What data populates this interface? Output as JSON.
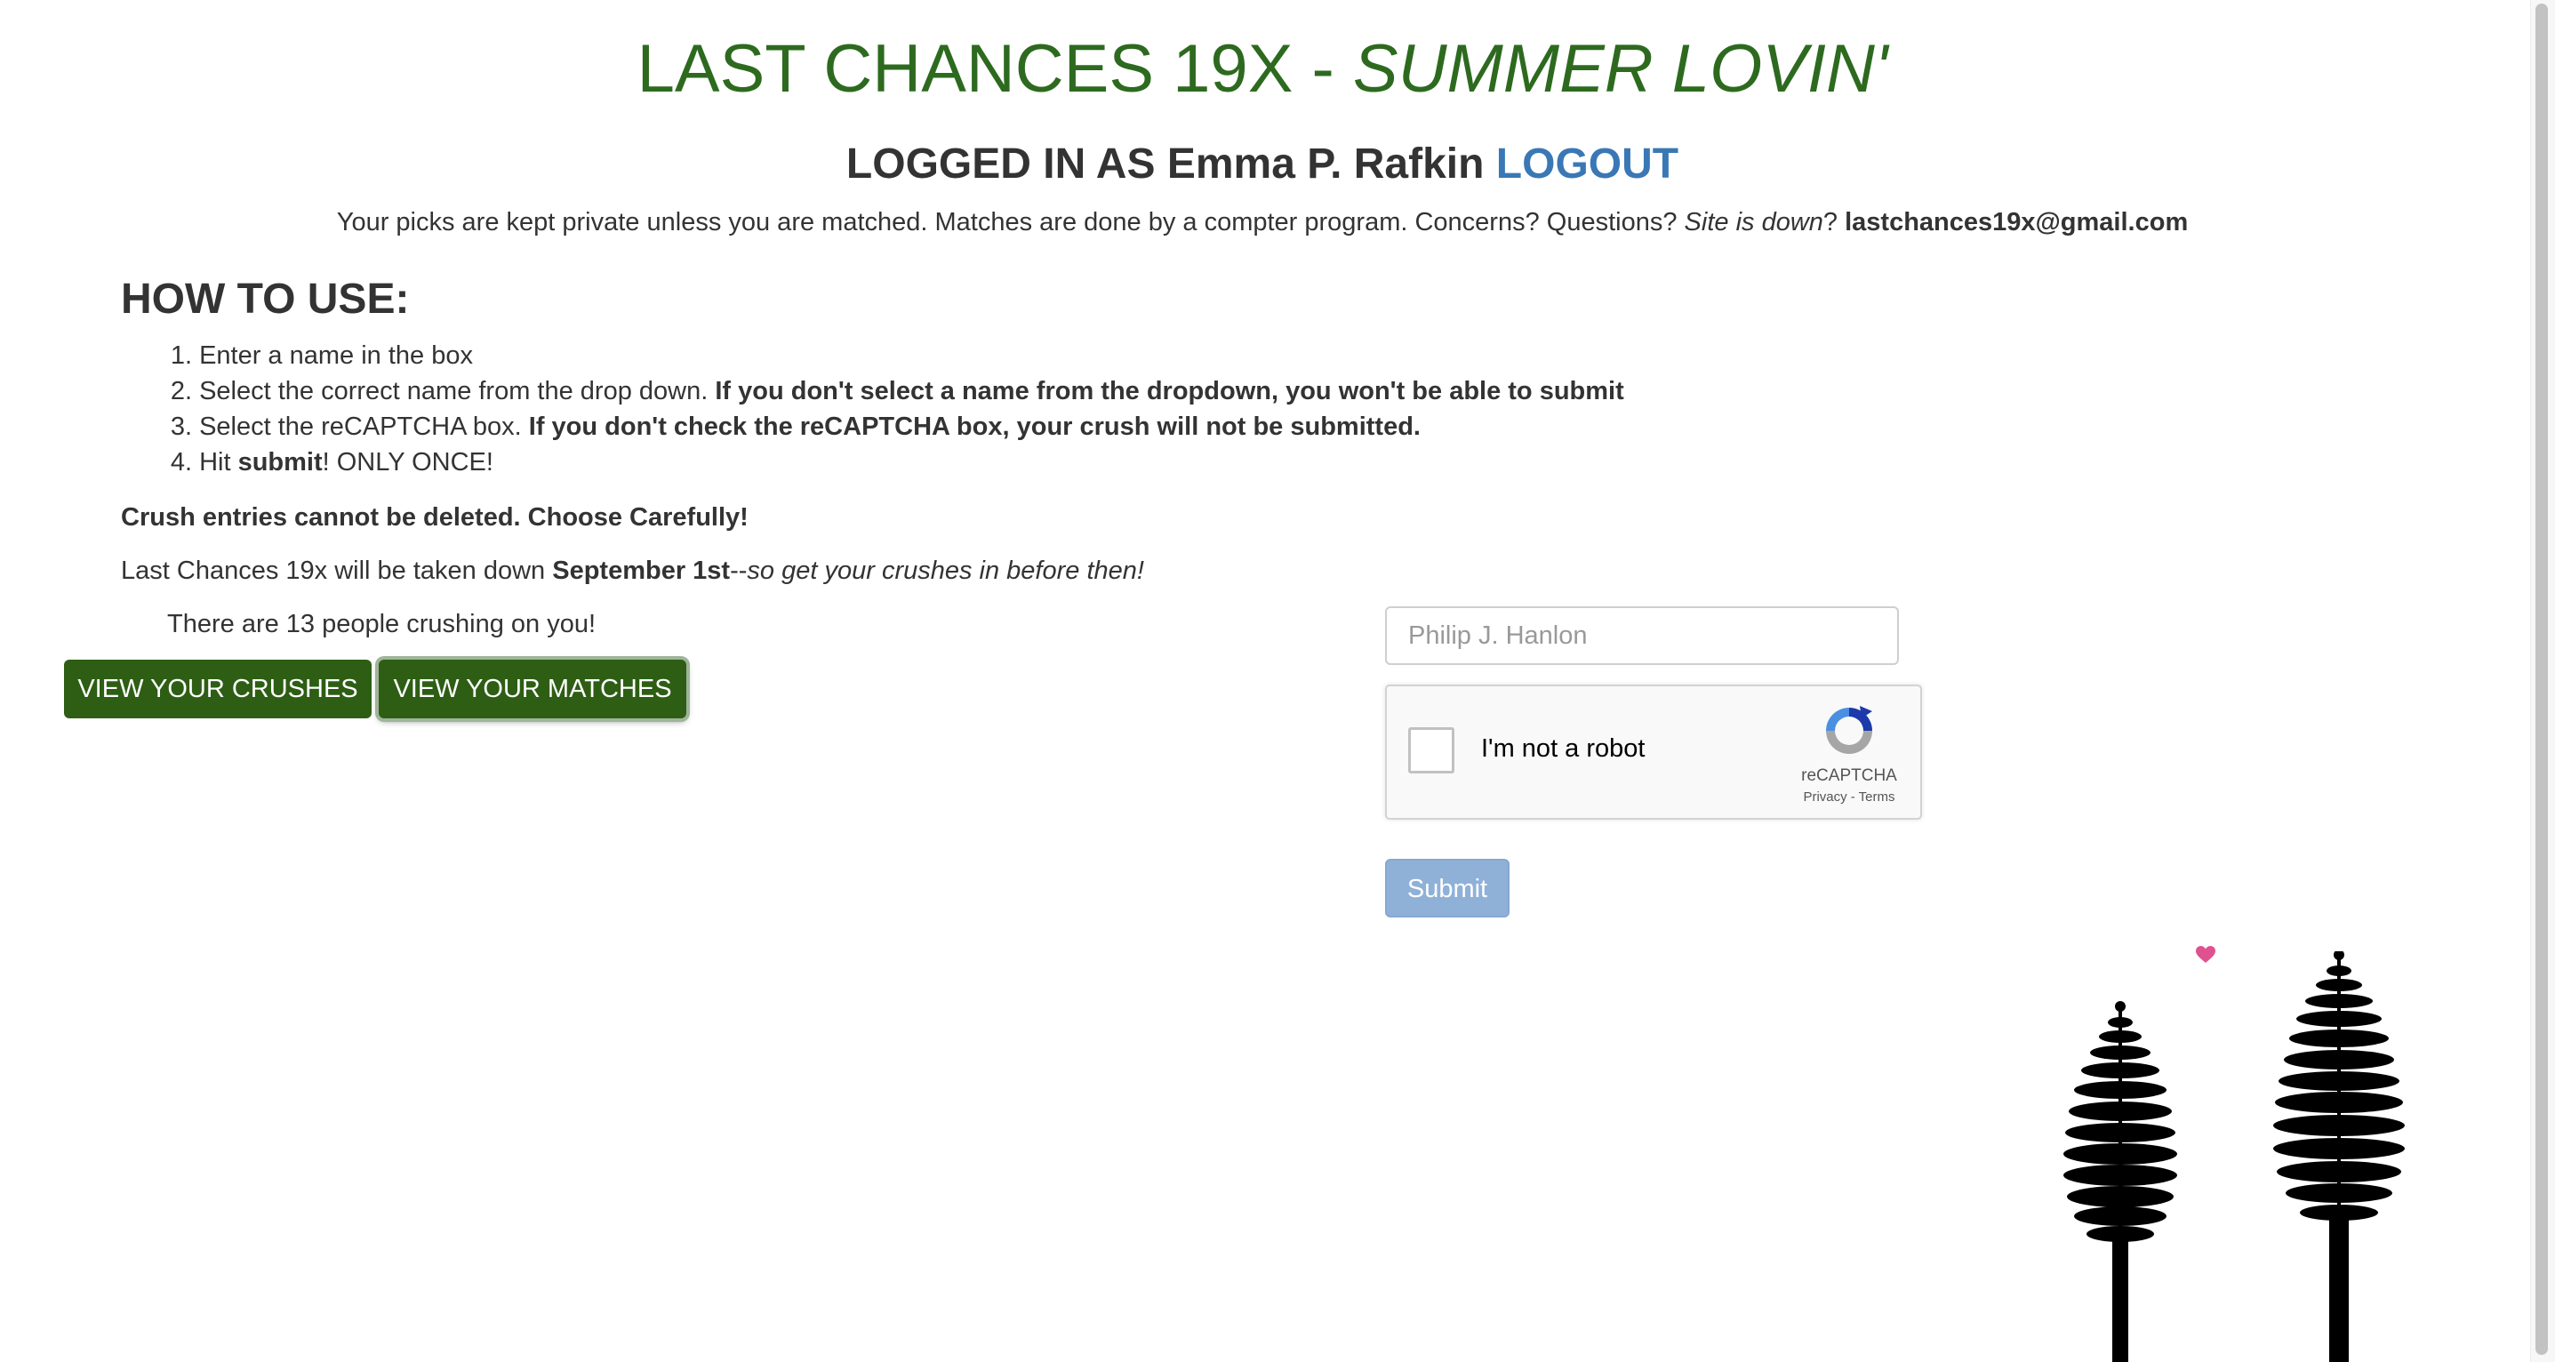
{
  "header": {
    "title_main": "LAST CHANCES 19X - ",
    "title_tail": "SUMMER LOVIN'",
    "logged_in_prefix": "LOGGED IN AS ",
    "user_name": "Emma P. Rafkin",
    "logout_label": "LOGOUT",
    "privacy_text": "Your picks are kept private unless you are matched. Matches are done by a compter program. Concerns? Questions? ",
    "site_down": "Site is down",
    "privacy_q": "? ",
    "email": "lastchances19x@gmail.com"
  },
  "instructions": {
    "heading": "HOW TO USE:",
    "steps": [
      {
        "num": "1.",
        "text": "Enter a name in the box",
        "bold": ""
      },
      {
        "num": "2.",
        "text": "Select the correct name from the drop down. ",
        "bold": "If you don't select a name from the dropdown, you won't be able to submit"
      },
      {
        "num": "3.",
        "text": "Select the reCAPTCHA box. ",
        "bold": "If you don't check the reCAPTCHA box, your crush will not be submitted."
      },
      {
        "num": "4.",
        "text_pre": "Hit ",
        "bold": "submit",
        "text_post": "! ONLY ONCE!"
      }
    ],
    "warning": "Crush entries cannot be deleted. Choose Carefully!",
    "takedown_pre": "Last Chances 19x will be taken down ",
    "takedown_date": "September 1st",
    "takedown_dash": "--",
    "takedown_tail": "so get your crushes in before then!"
  },
  "status": {
    "crush_count_text": "There are 13 people crushing on you!"
  },
  "buttons": {
    "view_crushes": "VIEW YOUR CRUSHES",
    "view_matches": "VIEW YOUR MATCHES"
  },
  "form": {
    "name_placeholder": "Philip J. Hanlon",
    "name_value": "",
    "recaptcha_label": "I'm not a robot",
    "recaptcha_brand": "reCAPTCHA",
    "recaptcha_links": "Privacy - Terms",
    "submit_label": "Submit"
  },
  "colors": {
    "title_green": "#2d6a1f",
    "button_green": "#2d5e14",
    "link_blue": "#3a78b5",
    "submit_disabled": "#8fb1d8",
    "heart_pink": "#e0518f"
  },
  "icons": {
    "heart": "heart-icon",
    "trees": "pine-trees-logo",
    "recaptcha": "recaptcha-logo-icon"
  }
}
